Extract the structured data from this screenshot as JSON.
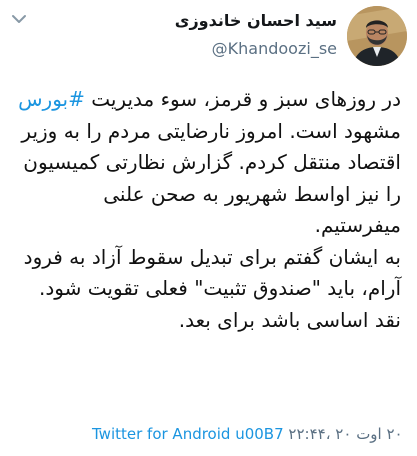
{
  "tweet": {
    "display_name": "سید احسان خاندوزی",
    "handle": "@Khandoozi_se",
    "body": {
      "line1": "در روزهای سبز و قرمز، سوء مدیریت",
      "hashtag": "#بورس",
      "line2_rest": " مشهود است. امروز نارضایتی مردم را به وزیر اقتصاد منتقل کردم. گزارش نظارتی کمیسیون را نیز اواسط شهریور به صحن علنی میفرستیم.",
      "paragraph2": "به ایشان گفتم برای تبدیل سقوط آزاد به فرود آرام، باید \"صندوق تثبیت\" فعلی تقویت شود.",
      "paragraph3": "نقد اساسی باشد برای بعد."
    },
    "footer": {
      "client": "Twitter for Android",
      "separator": " u00B7 ",
      "timestamp": "۲۰ اوت ۲۰ ،۲۲:۴۴"
    }
  },
  "icons": {
    "menu": "chevron-down-icon",
    "avatar": "profile-photo"
  },
  "colors": {
    "link": "#1b95e0",
    "secondary_text": "#5b7083",
    "primary_text": "#14171a"
  }
}
